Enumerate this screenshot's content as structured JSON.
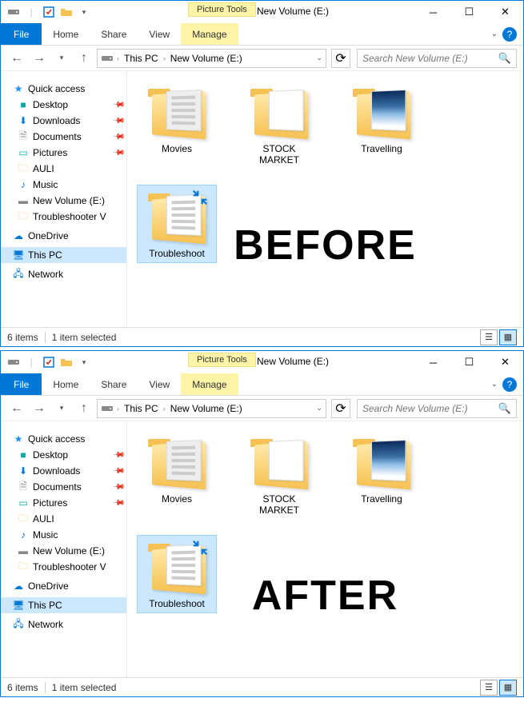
{
  "overlays": {
    "before": "BEFORE",
    "after": "AFTER"
  },
  "window": {
    "contextual_tab": "Picture Tools",
    "title": "New Volume (E:)"
  },
  "ribbon": {
    "file": "File",
    "tabs": [
      "Home",
      "Share",
      "View"
    ],
    "contextual": "Manage"
  },
  "breadcrumbs": [
    "This PC",
    "New Volume (E:)"
  ],
  "search": {
    "placeholder": "Search New Volume (E:)"
  },
  "nav": {
    "quick_access": "Quick access",
    "items": [
      {
        "label": "Desktop",
        "pinned": true,
        "icon": "desktop"
      },
      {
        "label": "Downloads",
        "pinned": true,
        "icon": "downloads"
      },
      {
        "label": "Documents",
        "pinned": true,
        "icon": "documents"
      },
      {
        "label": "Pictures",
        "pinned": true,
        "icon": "pictures"
      },
      {
        "label": "AULI",
        "pinned": false,
        "icon": "folder"
      },
      {
        "label": "Music",
        "pinned": false,
        "icon": "music"
      },
      {
        "label": "New Volume (E:)",
        "pinned": false,
        "icon": "drive"
      },
      {
        "label": "Troubleshooter V",
        "pinned": false,
        "icon": "folder"
      }
    ],
    "onedrive": "OneDrive",
    "this_pc": "This PC",
    "network": "Network"
  },
  "folders": [
    {
      "name": "Movies",
      "peek": "lines",
      "selected": false
    },
    {
      "name": "STOCK MARKET",
      "peek": "none",
      "selected": false
    },
    {
      "name": "Travelling",
      "peek": "img",
      "selected": false
    },
    {
      "name": "Troubleshoot",
      "peek": "doc",
      "selected": true
    }
  ],
  "status": {
    "items": "6 items",
    "selected": "1 item selected"
  }
}
